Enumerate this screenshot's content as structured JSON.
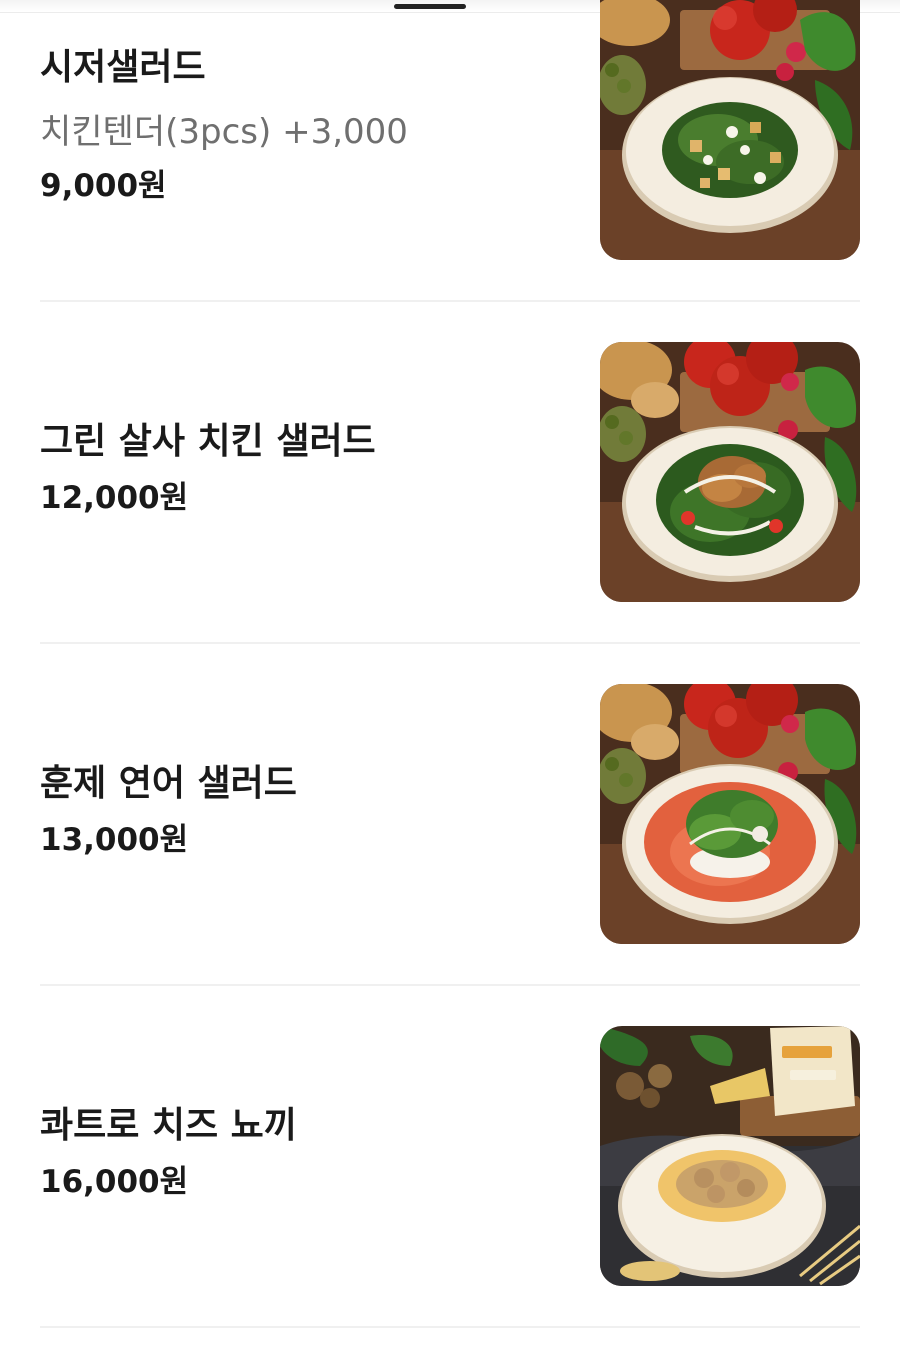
{
  "menu": {
    "items": [
      {
        "name": "시저샐러드",
        "option": "치킨텐더(3pcs) +3,000",
        "price": "9,000원",
        "photo_icon": "caesar-salad-photo"
      },
      {
        "name": "그린 살사 치킨 샐러드",
        "option": "",
        "price": "12,000원",
        "photo_icon": "green-salsa-chicken-salad-photo"
      },
      {
        "name": "훈제 연어 샐러드",
        "option": "",
        "price": "13,000원",
        "photo_icon": "smoked-salmon-salad-photo"
      },
      {
        "name": "콰트로 치즈 뇨끼",
        "option": "",
        "price": "16,000원",
        "photo_icon": "quattro-cheese-gnocchi-photo"
      }
    ]
  },
  "colors": {
    "text_primary": "#1a1a1a",
    "text_secondary": "#6f6f6f",
    "divider": "#f0f0f0",
    "table_wood": "#5a3a26",
    "plate": "#f4ede0"
  }
}
